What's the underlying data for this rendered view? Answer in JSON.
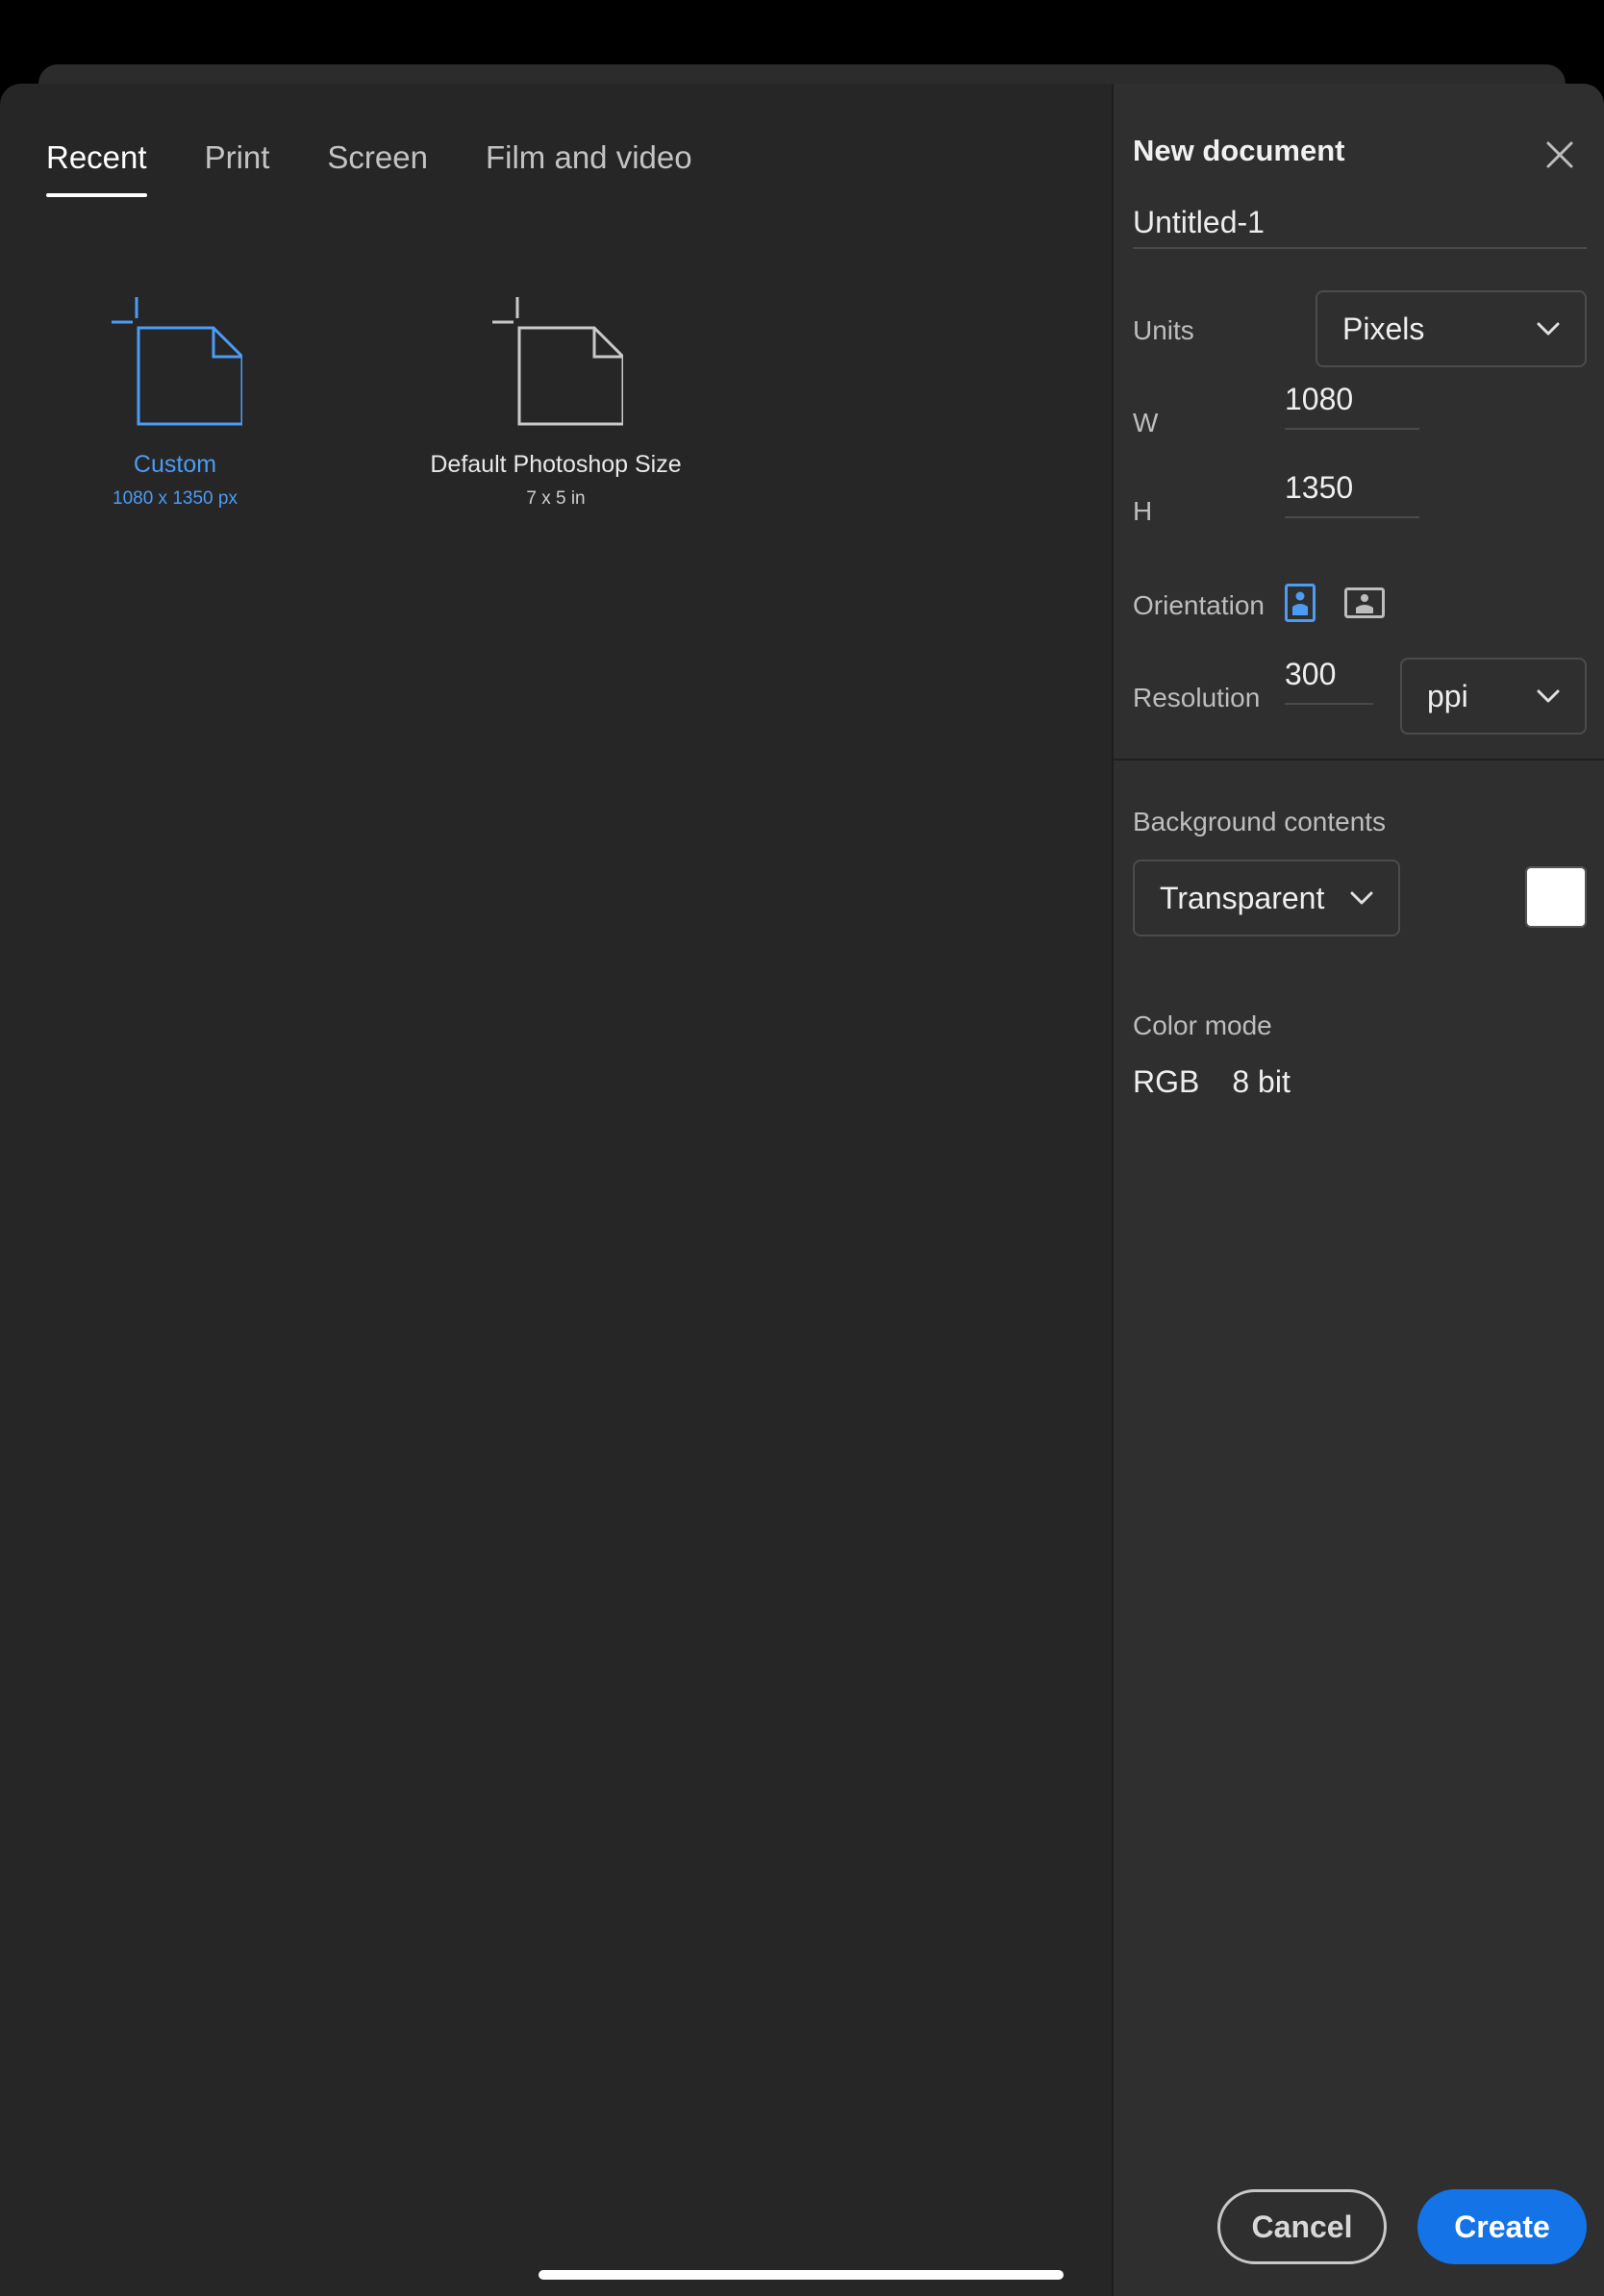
{
  "tabs": [
    {
      "label": "Recent",
      "active": true
    },
    {
      "label": "Print",
      "active": false
    },
    {
      "label": "Screen",
      "active": false
    },
    {
      "label": "Film and video",
      "active": false
    }
  ],
  "presets": [
    {
      "name": "Custom",
      "size": "1080 x 1350 px",
      "selected": true,
      "icon": "new-document-icon"
    },
    {
      "name": "Default Photoshop Size",
      "size": "7 x 5 in",
      "selected": false,
      "icon": "new-document-icon"
    }
  ],
  "panel": {
    "title": "New document",
    "document_name": "Untitled-1",
    "units_label": "Units",
    "units_value": "Pixels",
    "width_label": "W",
    "width_value": "1080",
    "height_label": "H",
    "height_value": "1350",
    "orientation_label": "Orientation",
    "orientation_selected": "portrait",
    "resolution_label": "Resolution",
    "resolution_value": "300",
    "resolution_unit": "ppi",
    "background_label": "Background contents",
    "background_value": "Transparent",
    "background_color": "#ffffff",
    "color_mode_label": "Color mode",
    "color_mode_value": "RGB",
    "bit_depth_value": "8 bit"
  },
  "buttons": {
    "cancel": "Cancel",
    "create": "Create"
  },
  "colors": {
    "accent": "#1473e6",
    "selected_text": "#4b9cf5",
    "background": "#262626",
    "panel": "#2f2f2f"
  }
}
